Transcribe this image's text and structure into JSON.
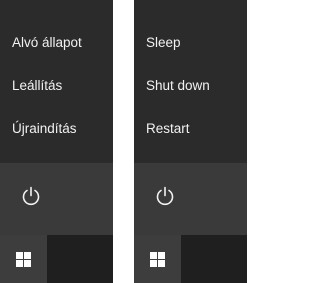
{
  "panels": [
    {
      "language": "Hungarian",
      "power_options": [
        "Alvó állapot",
        "Leállítás",
        "Újraindítás"
      ],
      "power_icon": "power-icon",
      "start_icon": "windows-logo-icon"
    },
    {
      "language": "English",
      "power_options": [
        "Sleep",
        "Shut down",
        "Restart"
      ],
      "power_icon": "power-icon",
      "start_icon": "windows-logo-icon"
    }
  ],
  "colors": {
    "menu_bg": "#2b2b2b",
    "power_row_bg": "#3a3a3a",
    "taskbar_bg": "#1f1f1f",
    "start_button_bg": "#3d3d3d",
    "text": "#f2f2f2"
  }
}
